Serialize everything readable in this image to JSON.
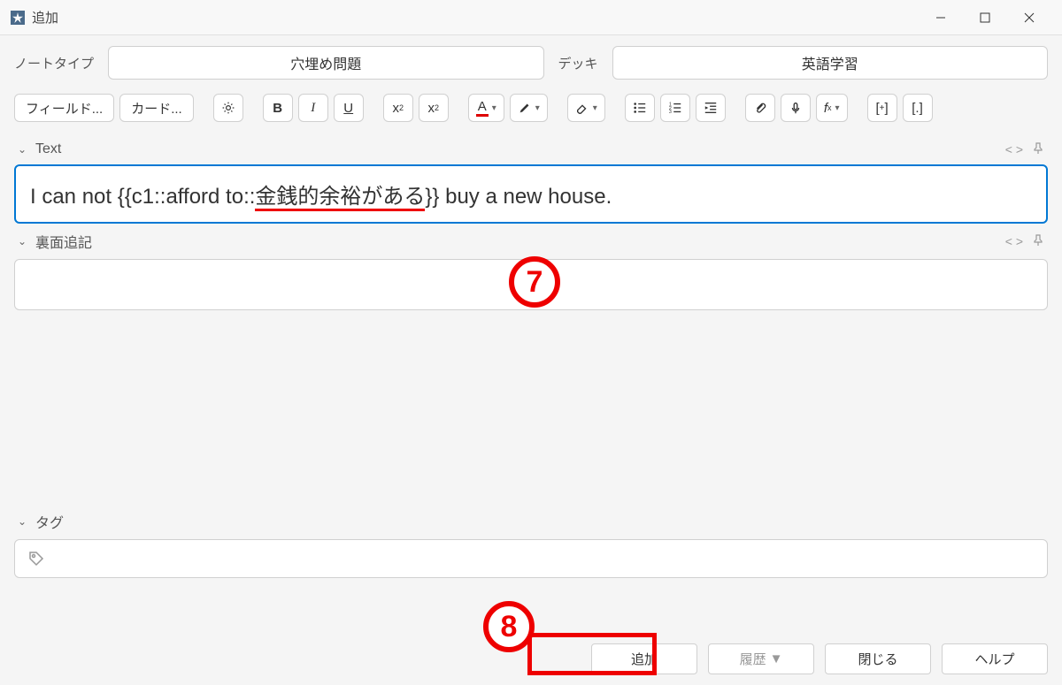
{
  "window": {
    "title": "追加"
  },
  "selectors": {
    "note_type_label": "ノートタイプ",
    "note_type_value": "穴埋め問題",
    "deck_label": "デッキ",
    "deck_value": "英語学習"
  },
  "toolbar": {
    "fields_btn": "フィールド...",
    "cards_btn": "カード..."
  },
  "fields": {
    "text_label": "Text",
    "text_value_pre": "I can not {{c1::afford to::",
    "text_value_hint": "金銭的余裕がある",
    "text_value_post": "}} buy a new house.",
    "back_label": "裏面追記",
    "back_value": "",
    "tag_label": "タグ"
  },
  "footer": {
    "add": "追加",
    "history": "履歴",
    "close": "閉じる",
    "help": "ヘルプ"
  },
  "annotations": {
    "seven": "7",
    "eight": "8"
  }
}
